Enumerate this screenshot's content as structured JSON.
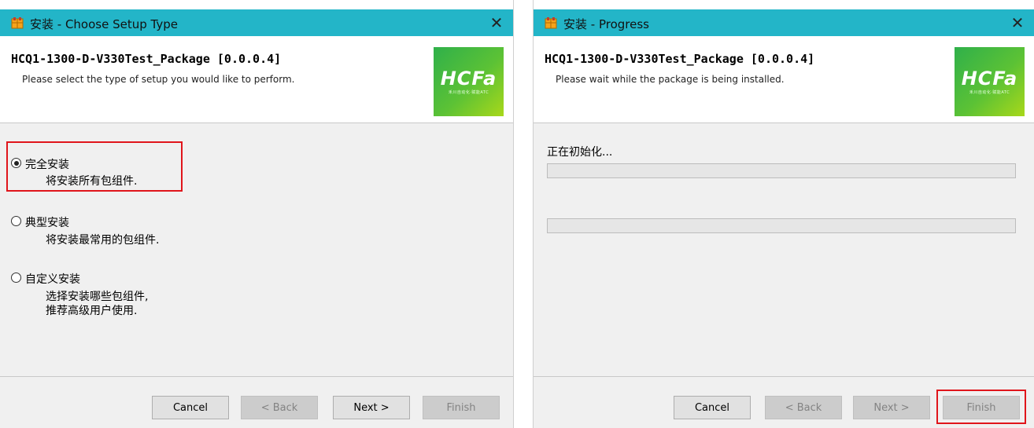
{
  "window1": {
    "title": "安装 - Choose Setup Type",
    "close": "✕",
    "package_title": "HCQ1-1300-D-V330Test_Package [0.0.0.4]",
    "subtitle": "Please select the type of setup you would like to perform.",
    "logo": {
      "text": "HCFa",
      "sub": "禾川自动化·赋能ATC"
    },
    "options": [
      {
        "label": "完全安装",
        "desc": "将安装所有包组件.",
        "selected": true
      },
      {
        "label": "典型安装",
        "desc": "将安装最常用的包组件.",
        "selected": false
      },
      {
        "label": "自定义安装",
        "desc": "选择安装哪些包组件,\n推荐高级用户使用.",
        "selected": false
      }
    ],
    "buttons": {
      "cancel": "Cancel",
      "back": "< Back",
      "next": "Next >",
      "finish": "Finish"
    }
  },
  "window2": {
    "title": "安装 - Progress",
    "close": "✕",
    "package_title": "HCQ1-1300-D-V330Test_Package [0.0.0.4]",
    "subtitle": "Please wait while the package is being installed.",
    "logo": {
      "text": "HCFa",
      "sub": "禾川自动化·赋能ATC"
    },
    "status": "正在初始化...",
    "progress1": 0,
    "progress2": 0,
    "buttons": {
      "cancel": "Cancel",
      "back": "< Back",
      "next": "Next >",
      "finish": "Finish"
    }
  },
  "colors": {
    "titlebar": "#23b5c8",
    "highlight": "#e0151b",
    "logo": "#5cc235"
  }
}
